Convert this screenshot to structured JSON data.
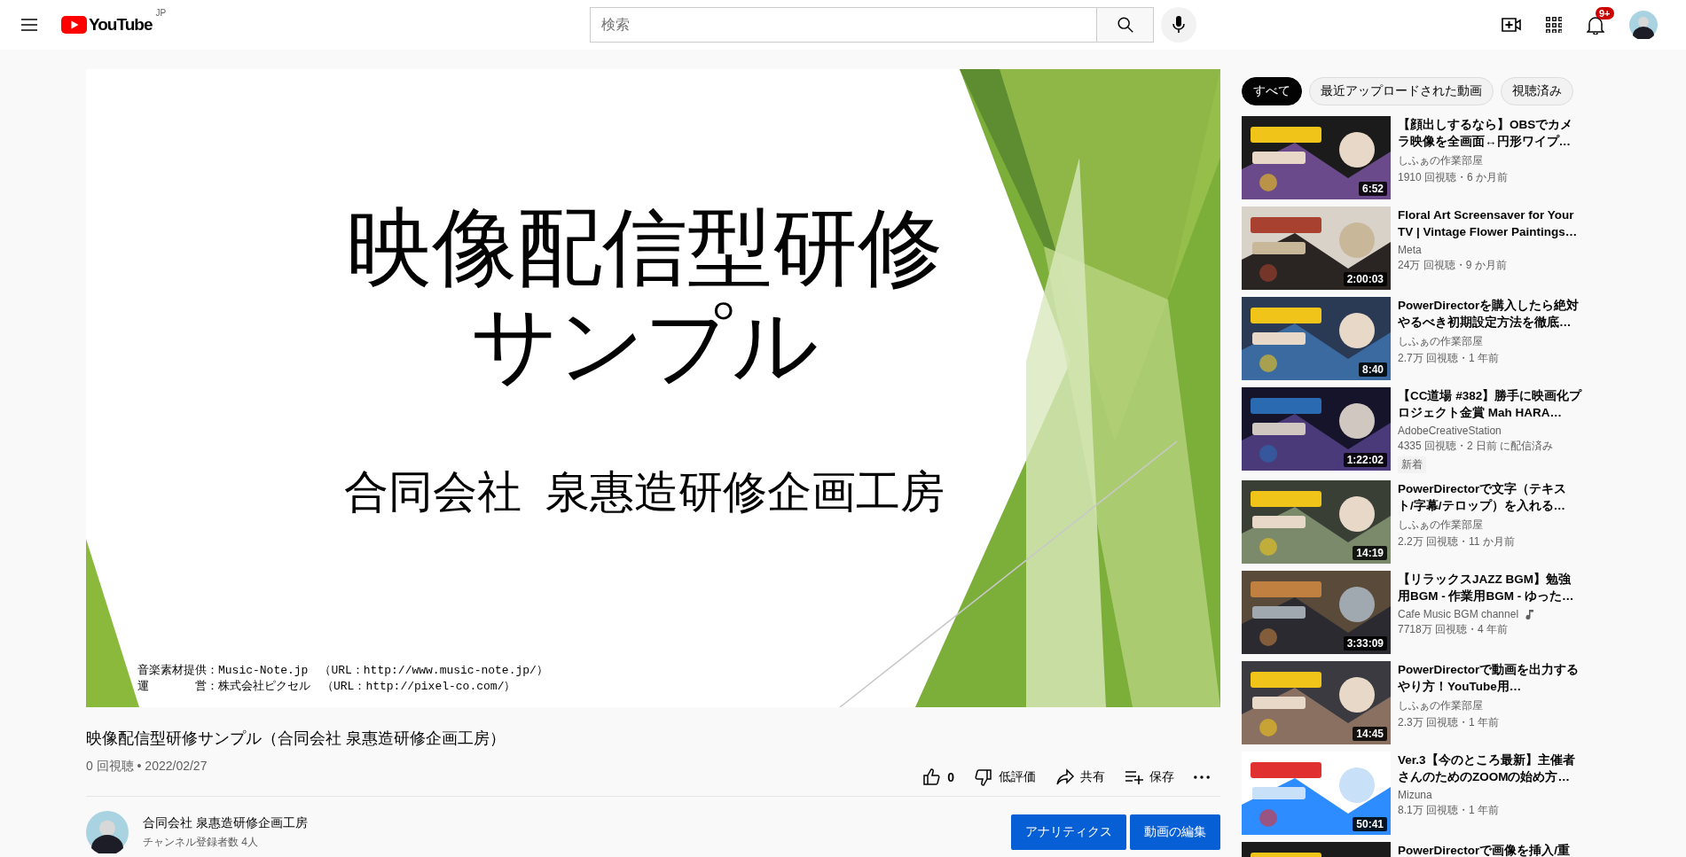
{
  "header": {
    "logo": "YouTube",
    "region": "JP",
    "search": {
      "placeholder": "検索"
    },
    "notifications": "9+"
  },
  "player": {
    "slide": {
      "title_lines": [
        "映像配信型研修",
        "サンプル"
      ],
      "subtitle": "合同会社  泉惠造研修企画工房",
      "credits": [
        "音楽素材提供：Music-Note.jp　（URL：http://www.music-note.jp/）",
        "運　　　　営：株式会社ピクセル　（URL：http://pixel-co.com/）"
      ]
    }
  },
  "video": {
    "title": "映像配信型研修サンプル（合同会社 泉惠造研修企画工房）",
    "meta": "0 回視聴 • 2022/02/27",
    "actions": [
      {
        "kind": "like",
        "label": "0"
      },
      {
        "kind": "dislike",
        "label": "低評価"
      },
      {
        "kind": "share",
        "label": "共有"
      },
      {
        "kind": "save",
        "label": "保存"
      },
      {
        "kind": "more"
      }
    ]
  },
  "channel": {
    "name": "合同会社 泉惠造研修企画工房",
    "subscribers": "チャンネル登録者数 4人",
    "buttons": [
      "アナリティクス",
      "動画の編集"
    ]
  },
  "chips": [
    {
      "label": "すべて",
      "selected": true
    },
    {
      "label": "最近アップロードされた動画",
      "selected": false
    },
    {
      "label": "視聴済み",
      "selected": false
    }
  ],
  "recommendations": [
    {
      "title": "【顔出しするなら】OBSでカメラ映像を全画面↔円形ワイプ…",
      "channel": "しふぁの作業部屋",
      "music": false,
      "meta": "1910 回視聴・6 か月前",
      "duration": "6:52"
    },
    {
      "title": "Floral Art Screensaver for Your TV | Vintage Flower Paintings…",
      "channel": "Meta",
      "music": false,
      "meta": "24万 回視聴・9 か月前",
      "duration": "2:00:03"
    },
    {
      "title": "PowerDirectorを購入したら絶対やるべき初期設定方法を徹底…",
      "channel": "しふぁの作業部屋",
      "music": false,
      "meta": "2.7万 回視聴・1 年前",
      "duration": "8:40"
    },
    {
      "title": "【CC道場 #382】勝手に映画化プロジェクト金賞 Mah HARA…",
      "channel": "AdobeCreativeStation",
      "music": false,
      "meta": "4335 回視聴・2 日前 に配信済み",
      "badge": "新着",
      "duration": "1:22:02"
    },
    {
      "title": "PowerDirectorで文字（テキスト/字幕/テロップ）を入れる…",
      "channel": "しふぁの作業部屋",
      "music": false,
      "meta": "2.2万 回視聴・11 か月前",
      "duration": "14:19"
    },
    {
      "title": "【リラックスJAZZ BGM】勉強用BGM - 作業用BGM - ゆった…",
      "channel": "Cafe Music BGM channel",
      "music": true,
      "meta": "7718万 回視聴・4 年前",
      "duration": "3:33:09"
    },
    {
      "title": "PowerDirectorで動画を出力するやり方！YouTube用…",
      "channel": "しふぁの作業部屋",
      "music": false,
      "meta": "2.3万 回視聴・1 年前",
      "duration": "14:45"
    },
    {
      "title": "Ver.3【今のところ最新】主催者さんのためのZOOMの始め方…",
      "channel": "Mizuna",
      "music": false,
      "meta": "8.1万 回視聴・1 年前",
      "duration": "50:41"
    },
    {
      "title": "PowerDirectorで画像を挿入/重"
    }
  ]
}
